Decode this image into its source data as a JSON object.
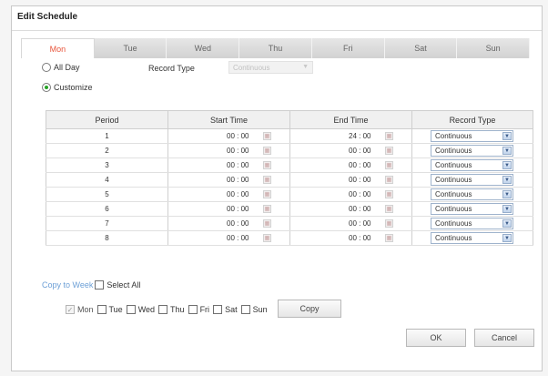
{
  "dialog": {
    "title": "Edit Schedule"
  },
  "tabs": [
    {
      "label": "Mon",
      "active": true
    },
    {
      "label": "Tue",
      "active": false
    },
    {
      "label": "Wed",
      "active": false
    },
    {
      "label": "Thu",
      "active": false
    },
    {
      "label": "Fri",
      "active": false
    },
    {
      "label": "Sat",
      "active": false
    },
    {
      "label": "Sun",
      "active": false
    }
  ],
  "options": {
    "all_day_label": "All Day",
    "all_day_checked": false,
    "record_type_label": "Record Type",
    "record_type_value": "Continuous",
    "customize_label": "Customize",
    "customize_checked": true
  },
  "table": {
    "headers": [
      "Period",
      "Start Time",
      "End Time",
      "Record Type"
    ],
    "rows": [
      {
        "period": "1",
        "start": "00 : 00",
        "end": "24 : 00",
        "type": "Continuous"
      },
      {
        "period": "2",
        "start": "00 : 00",
        "end": "00 : 00",
        "type": "Continuous"
      },
      {
        "period": "3",
        "start": "00 : 00",
        "end": "00 : 00",
        "type": "Continuous"
      },
      {
        "period": "4",
        "start": "00 : 00",
        "end": "00 : 00",
        "type": "Continuous"
      },
      {
        "period": "5",
        "start": "00 : 00",
        "end": "00 : 00",
        "type": "Continuous"
      },
      {
        "period": "6",
        "start": "00 : 00",
        "end": "00 : 00",
        "type": "Continuous"
      },
      {
        "period": "7",
        "start": "00 : 00",
        "end": "00 : 00",
        "type": "Continuous"
      },
      {
        "period": "8",
        "start": "00 : 00",
        "end": "00 : 00",
        "type": "Continuous"
      }
    ]
  },
  "copy": {
    "link_label": "Copy to Week",
    "select_all_label": "Select All",
    "days": [
      {
        "label": "Mon",
        "checked": true,
        "disabled": true
      },
      {
        "label": "Tue",
        "checked": false
      },
      {
        "label": "Wed",
        "checked": false
      },
      {
        "label": "Thu",
        "checked": false
      },
      {
        "label": "Fri",
        "checked": false
      },
      {
        "label": "Sat",
        "checked": false
      },
      {
        "label": "Sun",
        "checked": false
      }
    ],
    "copy_button": "Copy"
  },
  "buttons": {
    "ok": "OK",
    "cancel": "Cancel"
  },
  "icons": {
    "time_picker": "calendar-icon",
    "dropdown": "chevron-down-icon",
    "check": "checkmark-icon"
  },
  "colors": {
    "active_tab": "#e8553b",
    "link": "#6c9fd6",
    "radio_dot": "#27a327"
  }
}
